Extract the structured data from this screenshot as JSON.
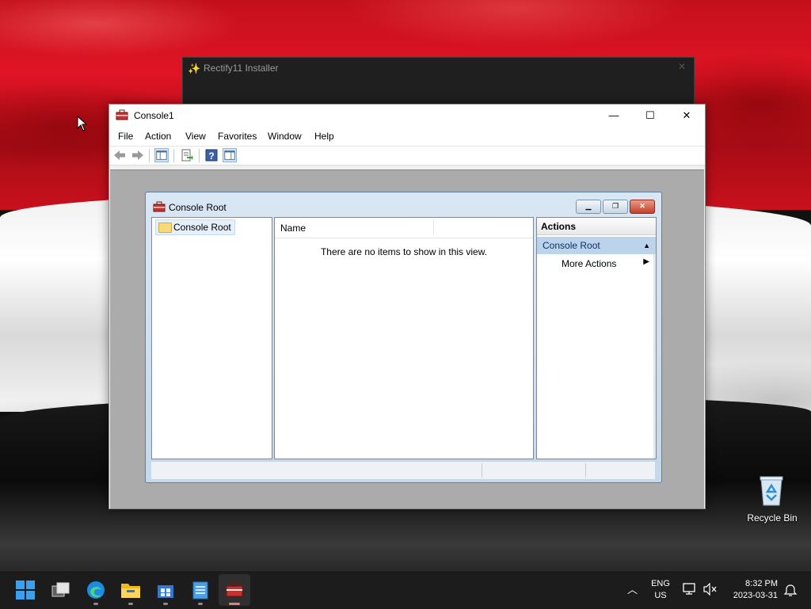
{
  "background_window": {
    "title": "Rectify11 Installer"
  },
  "console_window": {
    "title": "Console1",
    "caption": {
      "minimize": "—",
      "maximize": "☐",
      "close": "✕"
    },
    "menu": [
      "File",
      "Action",
      "View",
      "Favorites",
      "Window",
      "Help"
    ]
  },
  "mdi_child": {
    "title": "Console Root",
    "tree": {
      "root_label": "Console Root"
    },
    "list": {
      "column_name": "Name",
      "empty_message": "There are no items to show in this view."
    },
    "actions": {
      "header": "Actions",
      "section": "Console Root",
      "more": "More Actions"
    }
  },
  "desktop": {
    "recycle_bin_label": "Recycle Bin"
  },
  "taskbar": {
    "language_line1": "ENG",
    "language_line2": "US",
    "time": "8:32 PM",
    "date": "2023-03-31"
  },
  "colors": {
    "accent": "#5fb2f2",
    "mmc_actions_header": "#bcd3ec",
    "taskbar": "#1c1c1c"
  }
}
